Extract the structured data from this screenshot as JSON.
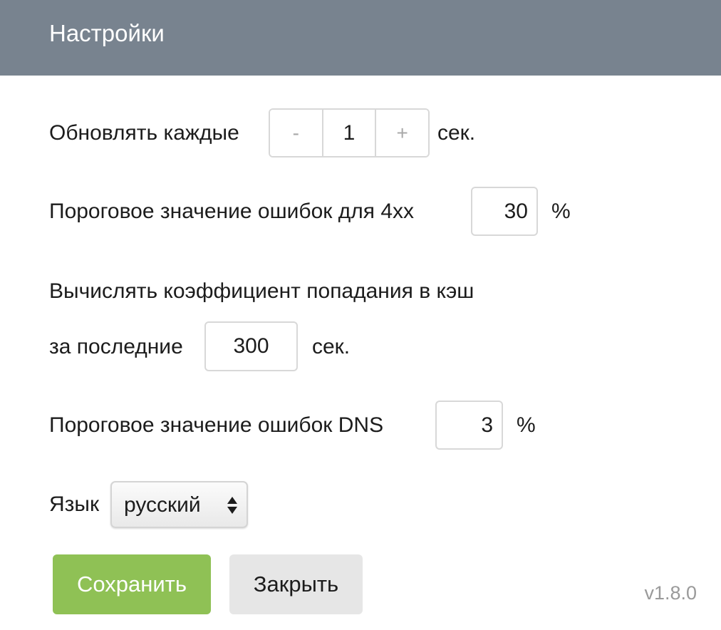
{
  "header": {
    "title": "Настройки"
  },
  "refresh": {
    "label": "Обновлять каждые",
    "decrement": "-",
    "value": "1",
    "increment": "+",
    "unit": "сек."
  },
  "error4xx": {
    "label": "Пороговое значение ошибок для 4xx",
    "value": "30",
    "unit": "%"
  },
  "cache": {
    "label_line1": "Вычислять коэффициент попадания в кэш",
    "label_line2": "за последние",
    "value": "300",
    "unit": "сек."
  },
  "dns": {
    "label": "Пороговое значение ошибок DNS",
    "value": "3",
    "unit": "%"
  },
  "language": {
    "label": "Язык",
    "selected": "русский",
    "icon": "select-arrows-icon"
  },
  "buttons": {
    "save": "Сохранить",
    "close": "Закрыть"
  },
  "version": "v1.8.0",
  "colors": {
    "header_bg": "#78838f",
    "save_bg": "#8fc155",
    "close_bg": "#e6e6e6"
  }
}
